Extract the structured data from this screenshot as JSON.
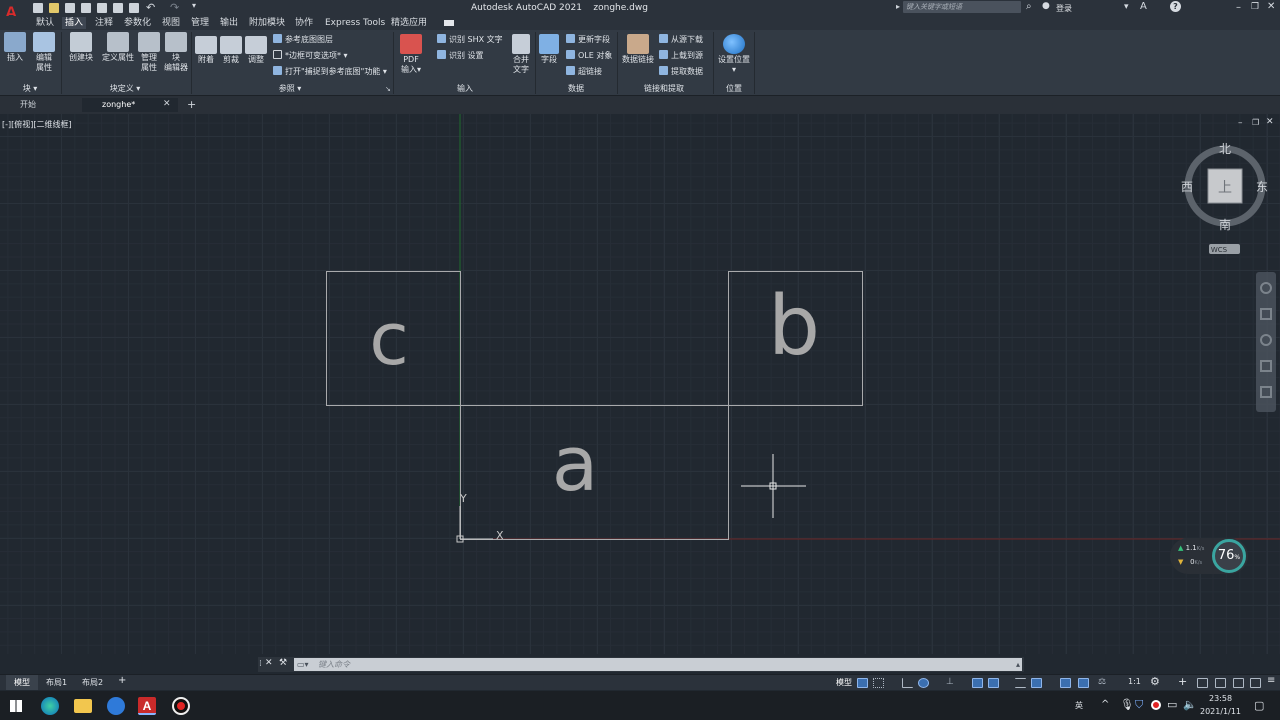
{
  "app": {
    "title": "Autodesk AutoCAD 2021",
    "filename": "zonghe.dwg",
    "search_placeholder": "键入关键字或短语",
    "login_label": "登录",
    "logo_letter": "A"
  },
  "menu": {
    "items": [
      "默认",
      "插入",
      "注释",
      "参数化",
      "视图",
      "管理",
      "输出",
      "附加模块",
      "协作",
      "Express Tools",
      "精选应用"
    ],
    "active_index": 1
  },
  "ribbon": {
    "block_group": {
      "label": "块",
      "insert": "插入",
      "edit_attr_1": "编辑",
      "edit_attr_2": "属性"
    },
    "blockdef_group": {
      "label": "块定义",
      "create": "创建块",
      "define_attr": "定义属性",
      "manage_1": "管理",
      "manage_2": "属性",
      "editor_1": "块",
      "editor_2": "编辑器"
    },
    "reference_group": {
      "label": "参照",
      "attach": "附着",
      "clip": "剪裁",
      "adjust": "调整",
      "underlay_layers": "参考底图图层",
      "frame_variable": "*边框可变选项*",
      "snap_underlay": "打开\"捕捉到参考底图\"功能"
    },
    "import_group": {
      "label": "输入",
      "pdf_1": "PDF",
      "pdf_2": "输入",
      "shx_recognize": "识别 SHX 文字",
      "shx_settings": "识别 设置",
      "combine_1": "合并",
      "combine_2": "文字"
    },
    "data_group": {
      "label": "数据",
      "field": "字段",
      "update_fields": "更新字段",
      "ole_object": "OLE 对象",
      "hyperlink": "超链接"
    },
    "link_group": {
      "label": "链接和提取",
      "data_link": "数据链接",
      "download_source": "从源下载",
      "upload_source": "上载到源",
      "extract_data": "提取数据"
    },
    "location_group": {
      "label": "位置",
      "set_location_1": "设置位置"
    }
  },
  "file_tabs": [
    {
      "label": "开始",
      "active": false
    },
    {
      "label": "zonghe*",
      "active": true
    }
  ],
  "viewport": {
    "view_label": "[-][俯视][二维线框]",
    "viewcube": {
      "north": "北",
      "south": "南",
      "east": "东",
      "west": "西",
      "top": "上",
      "wcs": "WCS"
    },
    "letters": {
      "a": "a",
      "b": "b",
      "c": "c"
    },
    "ucs": {
      "x": "X",
      "y": "Y"
    },
    "net_monitor": {
      "up": "1.1",
      "up_unit": "K/s",
      "down": "0",
      "down_unit": "K/s",
      "percent": "76",
      "percent_unit": "%"
    }
  },
  "command_line": {
    "placeholder": "键入命令"
  },
  "layout_tabs": [
    "模型",
    "布局1",
    "布局2"
  ],
  "status": {
    "model_label": "模型",
    "scale": "1:1"
  },
  "taskbar": {
    "time": "23:58",
    "date": "2021/1/11",
    "ime": "英"
  }
}
